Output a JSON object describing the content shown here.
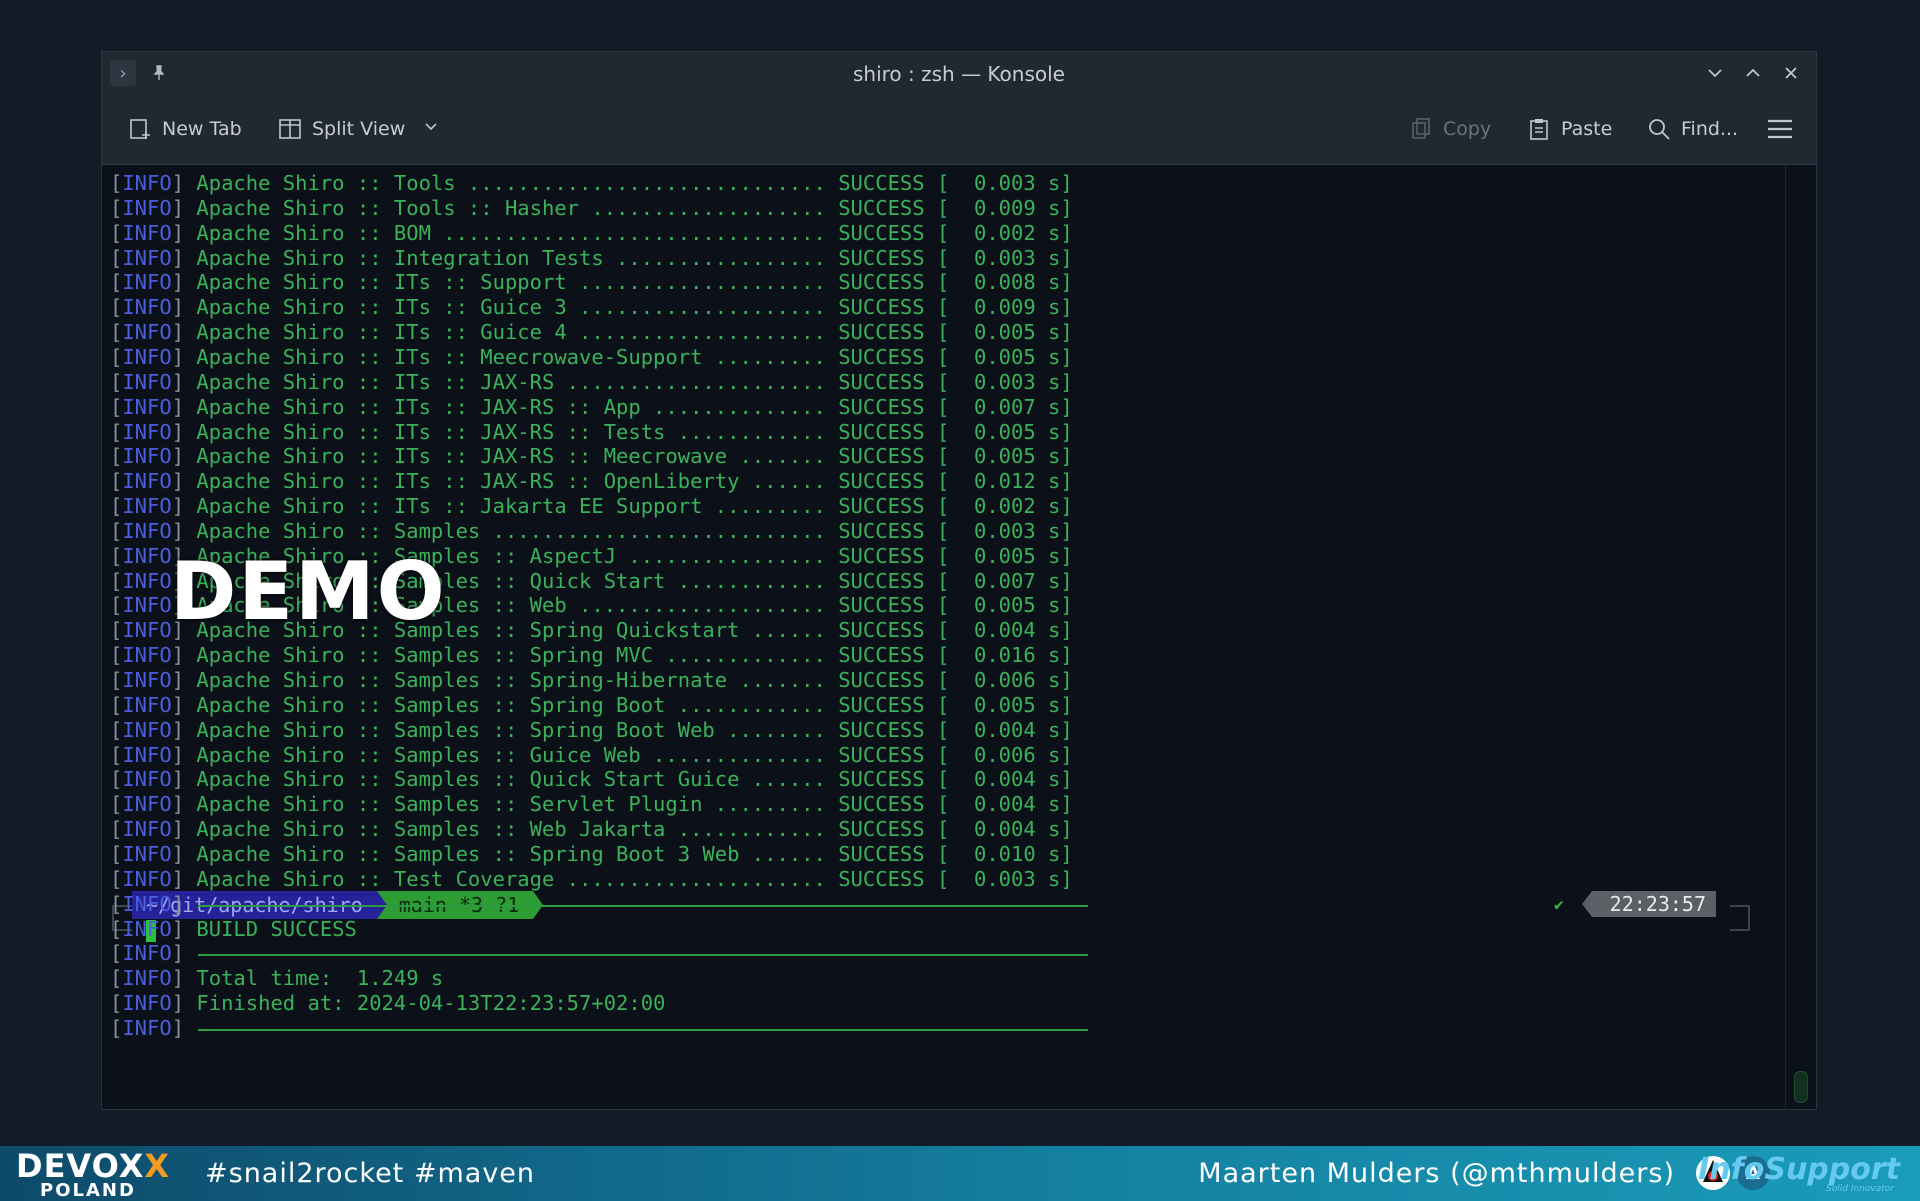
{
  "window": {
    "title": "shiro : zsh — Konsole"
  },
  "toolbar": {
    "new_tab": "New Tab",
    "split_view": "Split View",
    "copy": "Copy",
    "paste": "Paste",
    "find": "Find..."
  },
  "terminal": {
    "module_lines": [
      {
        "tag": "INFO",
        "name": "Apache Shiro :: Tools ............................. ",
        "status": "SUCCESS",
        "time": "[  0.003 s]"
      },
      {
        "tag": "INFO",
        "name": "Apache Shiro :: Tools :: Hasher ................... ",
        "status": "SUCCESS",
        "time": "[  0.009 s]"
      },
      {
        "tag": "INFO",
        "name": "Apache Shiro :: BOM ............................... ",
        "status": "SUCCESS",
        "time": "[  0.002 s]"
      },
      {
        "tag": "INFO",
        "name": "Apache Shiro :: Integration Tests ................. ",
        "status": "SUCCESS",
        "time": "[  0.003 s]"
      },
      {
        "tag": "INFO",
        "name": "Apache Shiro :: ITs :: Support .................... ",
        "status": "SUCCESS",
        "time": "[  0.008 s]"
      },
      {
        "tag": "INFO",
        "name": "Apache Shiro :: ITs :: Guice 3 .................... ",
        "status": "SUCCESS",
        "time": "[  0.009 s]"
      },
      {
        "tag": "INFO",
        "name": "Apache Shiro :: ITs :: Guice 4 .................... ",
        "status": "SUCCESS",
        "time": "[  0.005 s]"
      },
      {
        "tag": "INFO",
        "name": "Apache Shiro :: ITs :: Meecrowave-Support ......... ",
        "status": "SUCCESS",
        "time": "[  0.005 s]"
      },
      {
        "tag": "INFO",
        "name": "Apache Shiro :: ITs :: JAX-RS ..................... ",
        "status": "SUCCESS",
        "time": "[  0.003 s]"
      },
      {
        "tag": "INFO",
        "name": "Apache Shiro :: ITs :: JAX-RS :: App .............. ",
        "status": "SUCCESS",
        "time": "[  0.007 s]"
      },
      {
        "tag": "INFO",
        "name": "Apache Shiro :: ITs :: JAX-RS :: Tests ............ ",
        "status": "SUCCESS",
        "time": "[  0.005 s]"
      },
      {
        "tag": "INFO",
        "name": "Apache Shiro :: ITs :: JAX-RS :: Meecrowave ....... ",
        "status": "SUCCESS",
        "time": "[  0.005 s]"
      },
      {
        "tag": "INFO",
        "name": "Apache Shiro :: ITs :: JAX-RS :: OpenLiberty ...... ",
        "status": "SUCCESS",
        "time": "[  0.012 s]"
      },
      {
        "tag": "INFO",
        "name": "Apache Shiro :: ITs :: Jakarta EE Support ......... ",
        "status": "SUCCESS",
        "time": "[  0.002 s]"
      },
      {
        "tag": "INFO",
        "name": "Apache Shiro :: Samples ........................... ",
        "status": "SUCCESS",
        "time": "[  0.003 s]"
      },
      {
        "tag": "INFO",
        "name": "Apache Shiro :: Samples :: AspectJ ................ ",
        "status": "SUCCESS",
        "time": "[  0.005 s]"
      },
      {
        "tag": "INFO",
        "name": "Apache Shiro :: Samples :: Quick Start ............ ",
        "status": "SUCCESS",
        "time": "[  0.007 s]"
      },
      {
        "tag": "INFO",
        "name": "Apache Shiro :: Samples :: Web .................... ",
        "status": "SUCCESS",
        "time": "[  0.005 s]"
      },
      {
        "tag": "INFO",
        "name": "Apache Shiro :: Samples :: Spring Quickstart ...... ",
        "status": "SUCCESS",
        "time": "[  0.004 s]"
      },
      {
        "tag": "INFO",
        "name": "Apache Shiro :: Samples :: Spring MVC ............. ",
        "status": "SUCCESS",
        "time": "[  0.016 s]"
      },
      {
        "tag": "INFO",
        "name": "Apache Shiro :: Samples :: Spring-Hibernate ....... ",
        "status": "SUCCESS",
        "time": "[  0.006 s]"
      },
      {
        "tag": "INFO",
        "name": "Apache Shiro :: Samples :: Spring Boot ............ ",
        "status": "SUCCESS",
        "time": "[  0.005 s]"
      },
      {
        "tag": "INFO",
        "name": "Apache Shiro :: Samples :: Spring Boot Web ........ ",
        "status": "SUCCESS",
        "time": "[  0.004 s]"
      },
      {
        "tag": "INFO",
        "name": "Apache Shiro :: Samples :: Guice Web .............. ",
        "status": "SUCCESS",
        "time": "[  0.006 s]"
      },
      {
        "tag": "INFO",
        "name": "Apache Shiro :: Samples :: Quick Start Guice ...... ",
        "status": "SUCCESS",
        "time": "[  0.004 s]"
      },
      {
        "tag": "INFO",
        "name": "Apache Shiro :: Samples :: Servlet Plugin ......... ",
        "status": "SUCCESS",
        "time": "[  0.004 s]"
      },
      {
        "tag": "INFO",
        "name": "Apache Shiro :: Samples :: Web Jakarta ............ ",
        "status": "SUCCESS",
        "time": "[  0.004 s]"
      },
      {
        "tag": "INFO",
        "name": "Apache Shiro :: Samples :: Spring Boot 3 Web ...... ",
        "status": "SUCCESS",
        "time": "[  0.010 s]"
      },
      {
        "tag": "INFO",
        "name": "Apache Shiro :: Test Coverage ..................... ",
        "status": "SUCCESS",
        "time": "[  0.003 s]"
      }
    ],
    "summary_lines": [
      {
        "tag": "INFO",
        "text": "",
        "rule": true
      },
      {
        "tag": "INFO",
        "text": "BUILD SUCCESS",
        "rule": false
      },
      {
        "tag": "INFO",
        "text": "",
        "rule": true
      },
      {
        "tag": "INFO",
        "text": "Total time:  1.249 s",
        "rule": false
      },
      {
        "tag": "INFO",
        "text": "Finished at: 2024-04-13T22:23:57+02:00",
        "rule": false
      },
      {
        "tag": "INFO",
        "text": "",
        "rule": true
      }
    ],
    "prompt": {
      "path": "~/git/apache/shiro",
      "git": "main *3 ?1",
      "status_check": "✔",
      "time": "22:23:57"
    }
  },
  "overlay": {
    "demo": "DEMO"
  },
  "footer": {
    "brand": "DEVOX",
    "brand_x": "X",
    "brand_sub": "POLAND",
    "hashtags": "#snail2rocket #maven",
    "speaker": "Maarten Mulders (@mthmulders)",
    "badge_a": "A",
    "sponsor": "InfoSupport",
    "sponsor_tagline": "Solid Innovator"
  },
  "colors": {
    "terminal_green": "#3bb25a",
    "info_tag": "#4a5ee0",
    "prompt_path_bg": "#26239a",
    "prompt_git_bg": "#2c9c33",
    "footer_start": "#0e4a6a",
    "footer_end": "#1a9cb8"
  }
}
